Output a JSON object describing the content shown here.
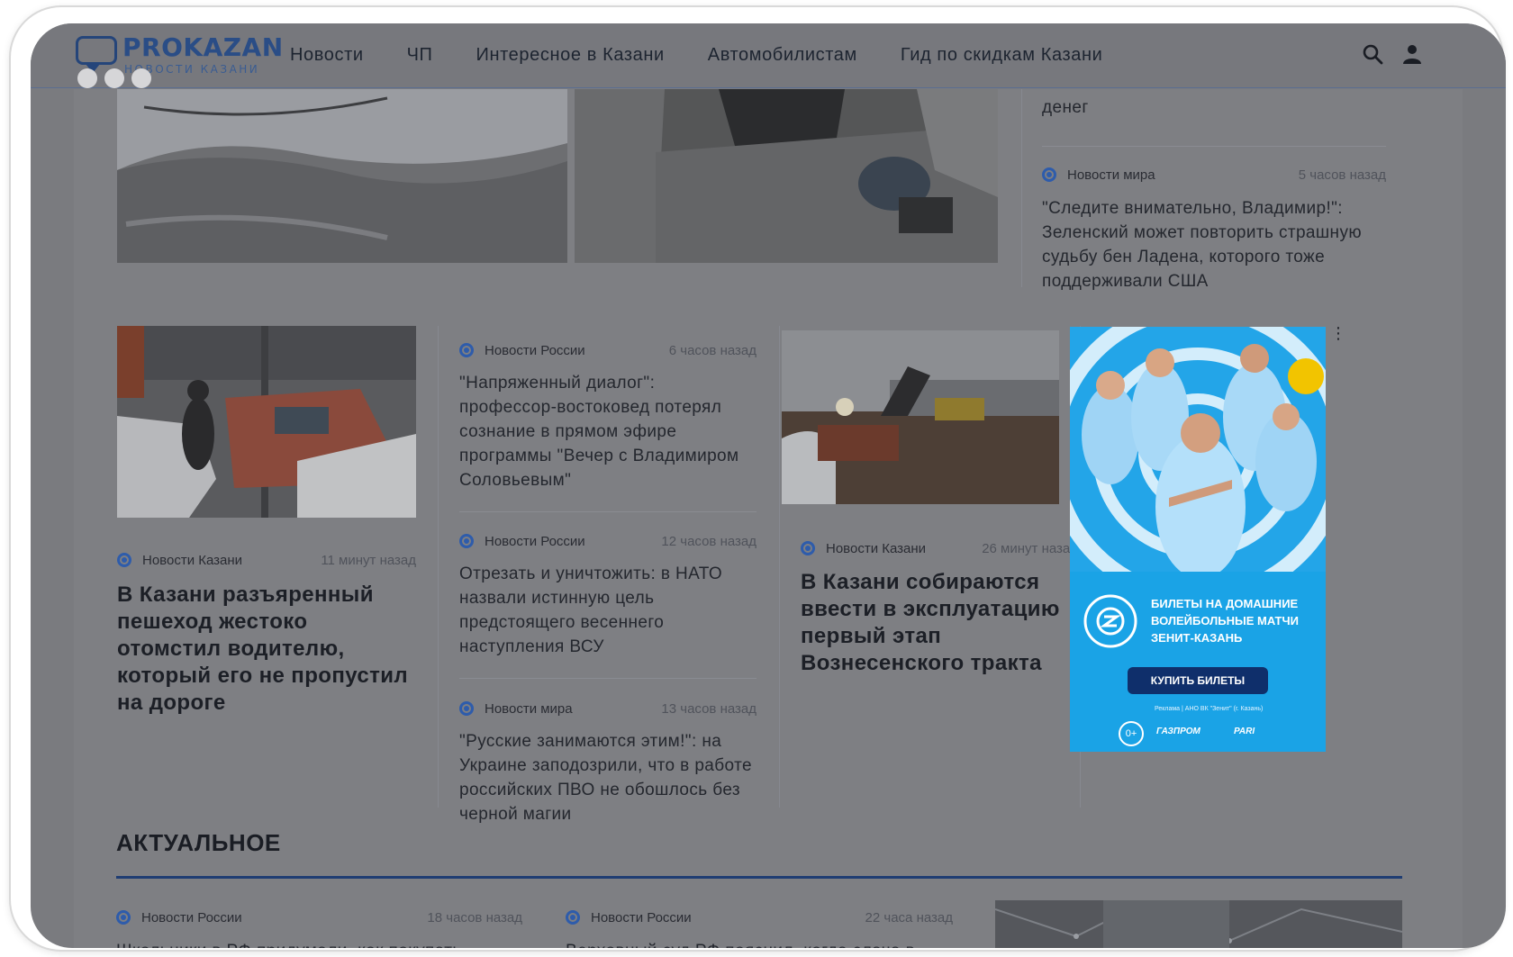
{
  "header": {
    "logo_title": "PROKAZAN",
    "logo_subtitle": "НОВОСТИ КАЗАНИ",
    "nav": [
      {
        "label": "Новости"
      },
      {
        "label": "ЧП"
      },
      {
        "label": "Интересное в Казани"
      },
      {
        "label": "Автомобилистам"
      },
      {
        "label": "Гид по скидкам Казани"
      }
    ],
    "icons": [
      "search-icon",
      "user-icon"
    ]
  },
  "top_right": {
    "partial_text": "денег",
    "item": {
      "category": "Новости мира",
      "time": "5 часов назад",
      "title": "\"Следите внимательно, Владимир!\": Зеленский может повторить страшную судьбу бен Ладена, которого тоже поддерживали США"
    }
  },
  "featured_left": {
    "category": "Новости Казани",
    "time": "11 минут назад",
    "title": "В Казани разъяренный пешеход жестоко отомстил водителю, который его не пропустил на дороге"
  },
  "middle_list": [
    {
      "category": "Новости России",
      "time": "6 часов назад",
      "title": "\"Напряженный диалог\": профессор-востоковед потерял сознание в прямом эфире программы \"Вечер с Владимиром Соловьевым\""
    },
    {
      "category": "Новости России",
      "time": "12 часов назад",
      "title": "Отрезать и уничтожить: в НАТО назвали истинную цель предстоящего весеннего наступления ВСУ"
    },
    {
      "category": "Новости мира",
      "time": "13 часов назад",
      "title": "\"Русские занимаются этим!\": на Украине заподозрили, что в работе российских ПВО не обошлось без черной магии"
    }
  ],
  "featured_right": {
    "category": "Новости Казани",
    "time": "26 минут назад",
    "title": "В Казани собираются ввести в эксплуатацию первый этап Вознесенского тракта"
  },
  "ad": {
    "logo_text": "ЗЕНИТ КАЗАНЬ",
    "headline": "БИЛЕТЫ НА ДОМАШНИЕ ВОЛЕЙБОЛЬНЫЕ МАТЧИ ЗЕНИТ-КАЗАНЬ",
    "button": "КУПИТЬ БИЛЕТЫ",
    "fine_print": "Реклама | АНО ВК \"Зенит\" (г. Казань)",
    "age": "0+",
    "sponsor1": "ГАЗПРОМ",
    "sponsor2": "PARI",
    "menu_icon": "vertical-dots-icon",
    "colors": {
      "background": "#1aa3e6",
      "button": "#0f2f6b"
    }
  },
  "section": {
    "title": "АКТУАЛЬНОЕ",
    "items": [
      {
        "category": "Новости России",
        "time": "18 часов назад",
        "title": "Школьники в РФ придумали, как покупать"
      },
      {
        "category": "Новости России",
        "time": "22 часа назад",
        "title": "Верховный суд РФ пояснил, когда слача в"
      }
    ]
  },
  "colors": {
    "accent": "#2e5cab",
    "brand": "#2a4d86"
  }
}
